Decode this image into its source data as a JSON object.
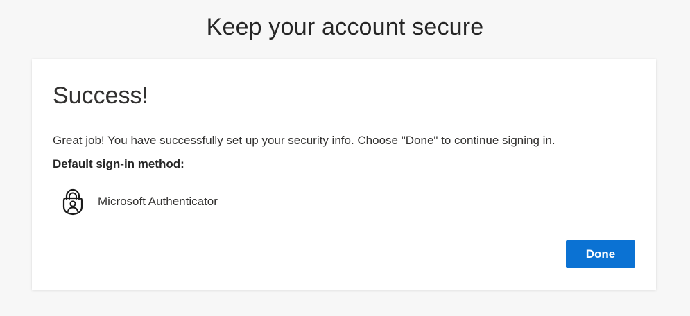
{
  "header": {
    "title": "Keep your account secure"
  },
  "card": {
    "title": "Success!",
    "message": "Great job! You have successfully set up your security info. Choose \"Done\" to continue signing in.",
    "default_method_heading": "Default sign-in method:",
    "method": {
      "icon": "authenticator-lock-icon",
      "label": "Microsoft Authenticator"
    },
    "done_label": "Done"
  },
  "colors": {
    "page_background": "#f7f7f7",
    "card_background": "#ffffff",
    "primary_button": "#0b72d3",
    "text": "#262626"
  }
}
